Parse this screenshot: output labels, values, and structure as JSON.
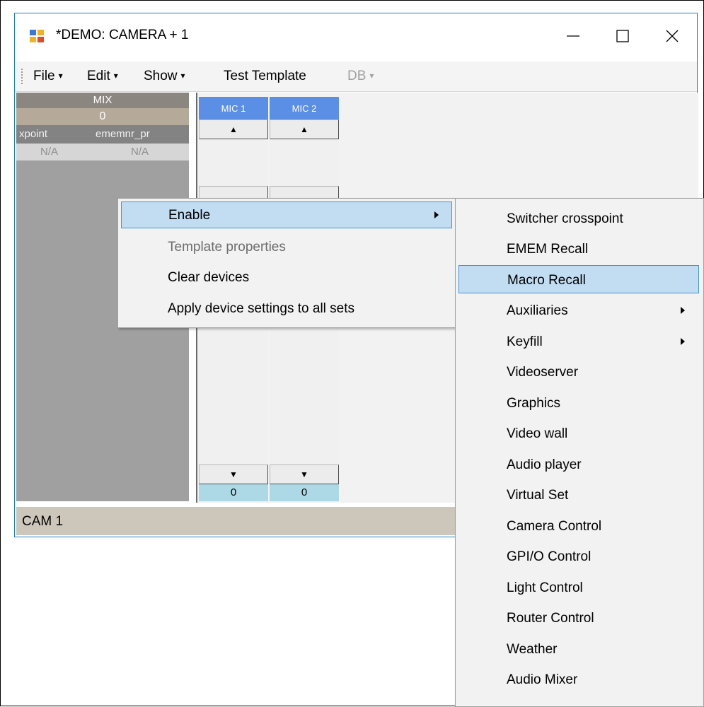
{
  "window": {
    "title": "*DEMO: CAMERA + 1",
    "icon": "app-icon",
    "controls": [
      "minimize-icon",
      "maximize-icon",
      "close-icon"
    ]
  },
  "menubar": {
    "items": [
      {
        "label": "File",
        "has_dropdown": true
      },
      {
        "label": "Edit",
        "has_dropdown": true
      },
      {
        "label": "Show",
        "has_dropdown": true
      },
      {
        "label": "Test Template",
        "has_dropdown": false
      },
      {
        "label": "DB",
        "has_dropdown": true,
        "disabled": true
      }
    ],
    "caret": "▾"
  },
  "left_panel": {
    "header": "MIX",
    "value": "0",
    "columns": [
      "xpoint",
      "ememnr_pr"
    ],
    "values": [
      "N/A",
      "N/A"
    ]
  },
  "mics": [
    {
      "label": "MIC 1",
      "value": "0"
    },
    {
      "label": "MIC 2",
      "value": "0"
    }
  ],
  "arrows": {
    "up": "▲",
    "down": "▼"
  },
  "statusbar": {
    "text": "CAM 1"
  },
  "context_menu": {
    "items": [
      {
        "label": "Enable",
        "highlighted": true,
        "has_submenu": true
      },
      {
        "label": "Template properties",
        "disabled": true
      },
      {
        "label": "Clear devices"
      },
      {
        "label": "Apply device settings to all sets"
      }
    ]
  },
  "submenu": {
    "items": [
      {
        "label": "Switcher crosspoint"
      },
      {
        "label": "EMEM Recall"
      },
      {
        "label": "Macro Recall",
        "highlighted": true
      },
      {
        "label": "Auxiliaries",
        "has_submenu": true
      },
      {
        "label": "Keyfill",
        "has_submenu": true
      },
      {
        "label": "Videoserver"
      },
      {
        "label": "Graphics"
      },
      {
        "label": "Video wall"
      },
      {
        "label": "Audio player"
      },
      {
        "label": "Virtual Set"
      },
      {
        "label": "Camera Control"
      },
      {
        "label": "GPI/O Control"
      },
      {
        "label": "Light Control"
      },
      {
        "label": "Router Control"
      },
      {
        "label": "Weather"
      },
      {
        "label": "Audio Mixer"
      }
    ]
  },
  "colors": {
    "mic_header": "#5b8ee5",
    "mic_value": "#add8e6",
    "highlight": "#c2dcf2",
    "highlight_border": "#3d95d9",
    "statusbar": "#cdc6bb"
  }
}
